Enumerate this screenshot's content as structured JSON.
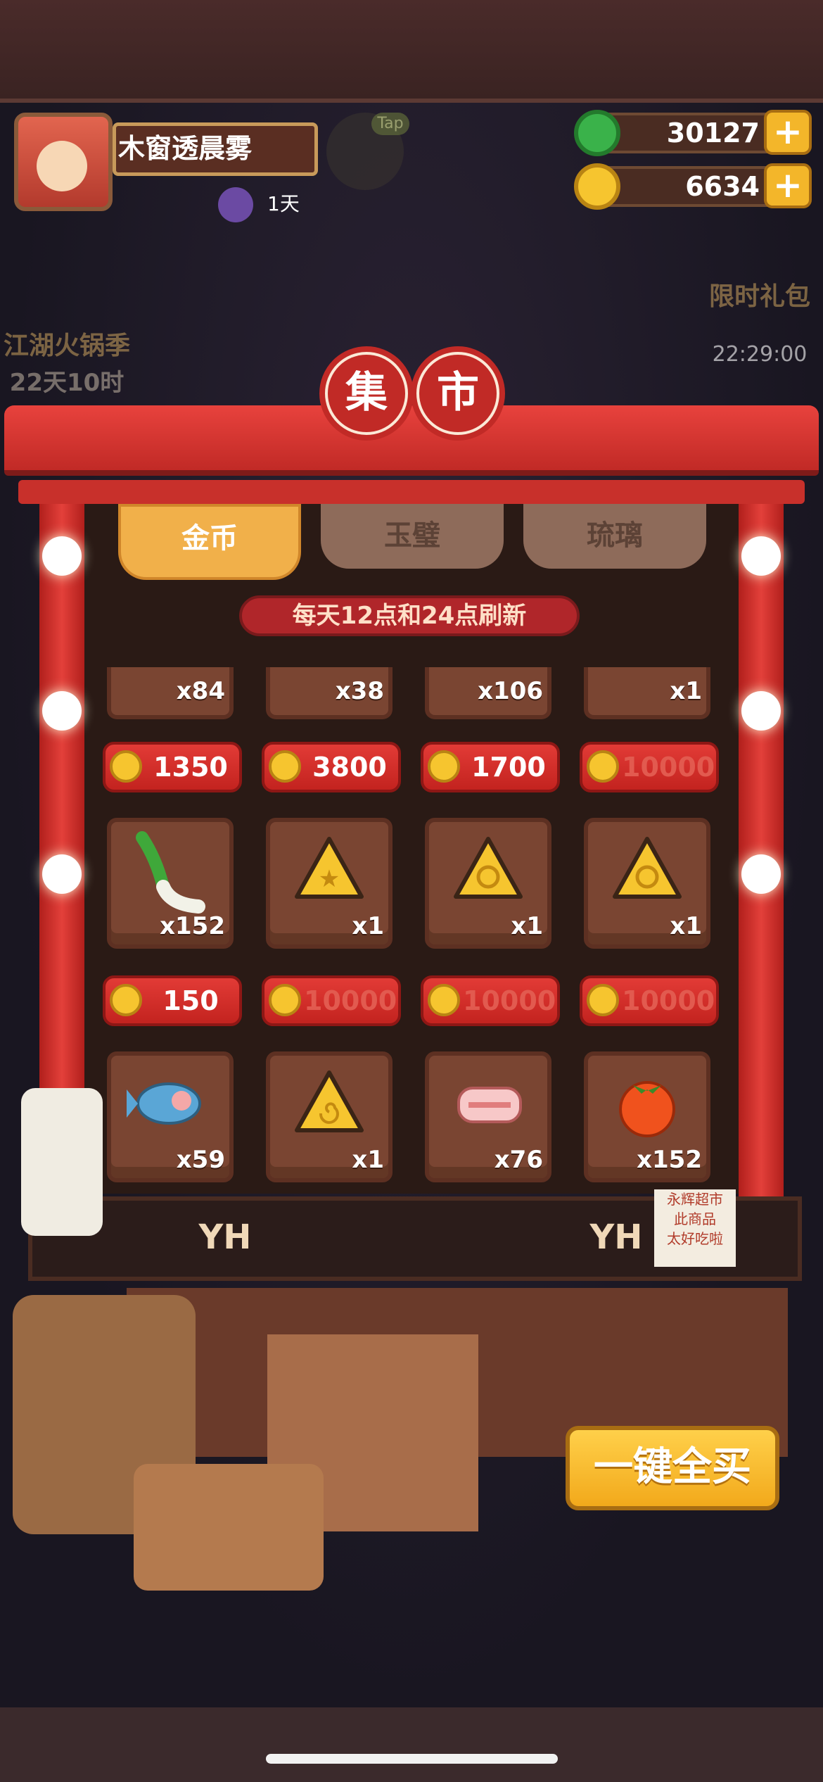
{
  "player": {
    "name": "木窗透晨雾",
    "days": "1天",
    "tap_label": "Tap"
  },
  "currency": {
    "jade": "30127",
    "coins": "6634",
    "plus": "+"
  },
  "events": {
    "left_title": "江湖火锅季",
    "left_time": "22天10时",
    "right_title": "限时礼包",
    "right_time": "22:29:00"
  },
  "shop": {
    "title_chars": [
      "集",
      "市"
    ],
    "tabs": [
      {
        "label": "金币",
        "active": true
      },
      {
        "label": "玉璧",
        "active": false
      },
      {
        "label": "琉璃",
        "active": false
      }
    ],
    "refresh_note": "每天12点和24点刷新",
    "top_partial_qty": [
      "x84",
      "x38",
      "x106",
      "x1"
    ],
    "rows": [
      {
        "prices": [
          "1350",
          "3800",
          "1700",
          "10000"
        ],
        "items": [
          {
            "icon": "leek-icon",
            "qty": "x152"
          },
          {
            "icon": "star-token-icon",
            "qty": "x1"
          },
          {
            "icon": "turtle-token-icon",
            "qty": "x1"
          },
          {
            "icon": "turtle-token-icon",
            "qty": "x1"
          }
        ]
      },
      {
        "prices": [
          "150",
          "10000",
          "10000",
          "10000"
        ],
        "items": [
          {
            "icon": "fish-icon",
            "qty": "x59"
          },
          {
            "icon": "spiral-token-icon",
            "qty": "x1"
          },
          {
            "icon": "bacon-roll-icon",
            "qty": "x76"
          },
          {
            "icon": "tomato-icon",
            "qty": "x152"
          }
        ]
      }
    ],
    "buy_all": "一键全买",
    "counter_sign": [
      "YH",
      "YH"
    ],
    "note_lines": [
      "永辉超市",
      "此商品",
      "太好吃啦"
    ]
  },
  "colors": {
    "accent_red": "#c12a26",
    "gold": "#f3b62a",
    "jade": "#3ab24a"
  }
}
